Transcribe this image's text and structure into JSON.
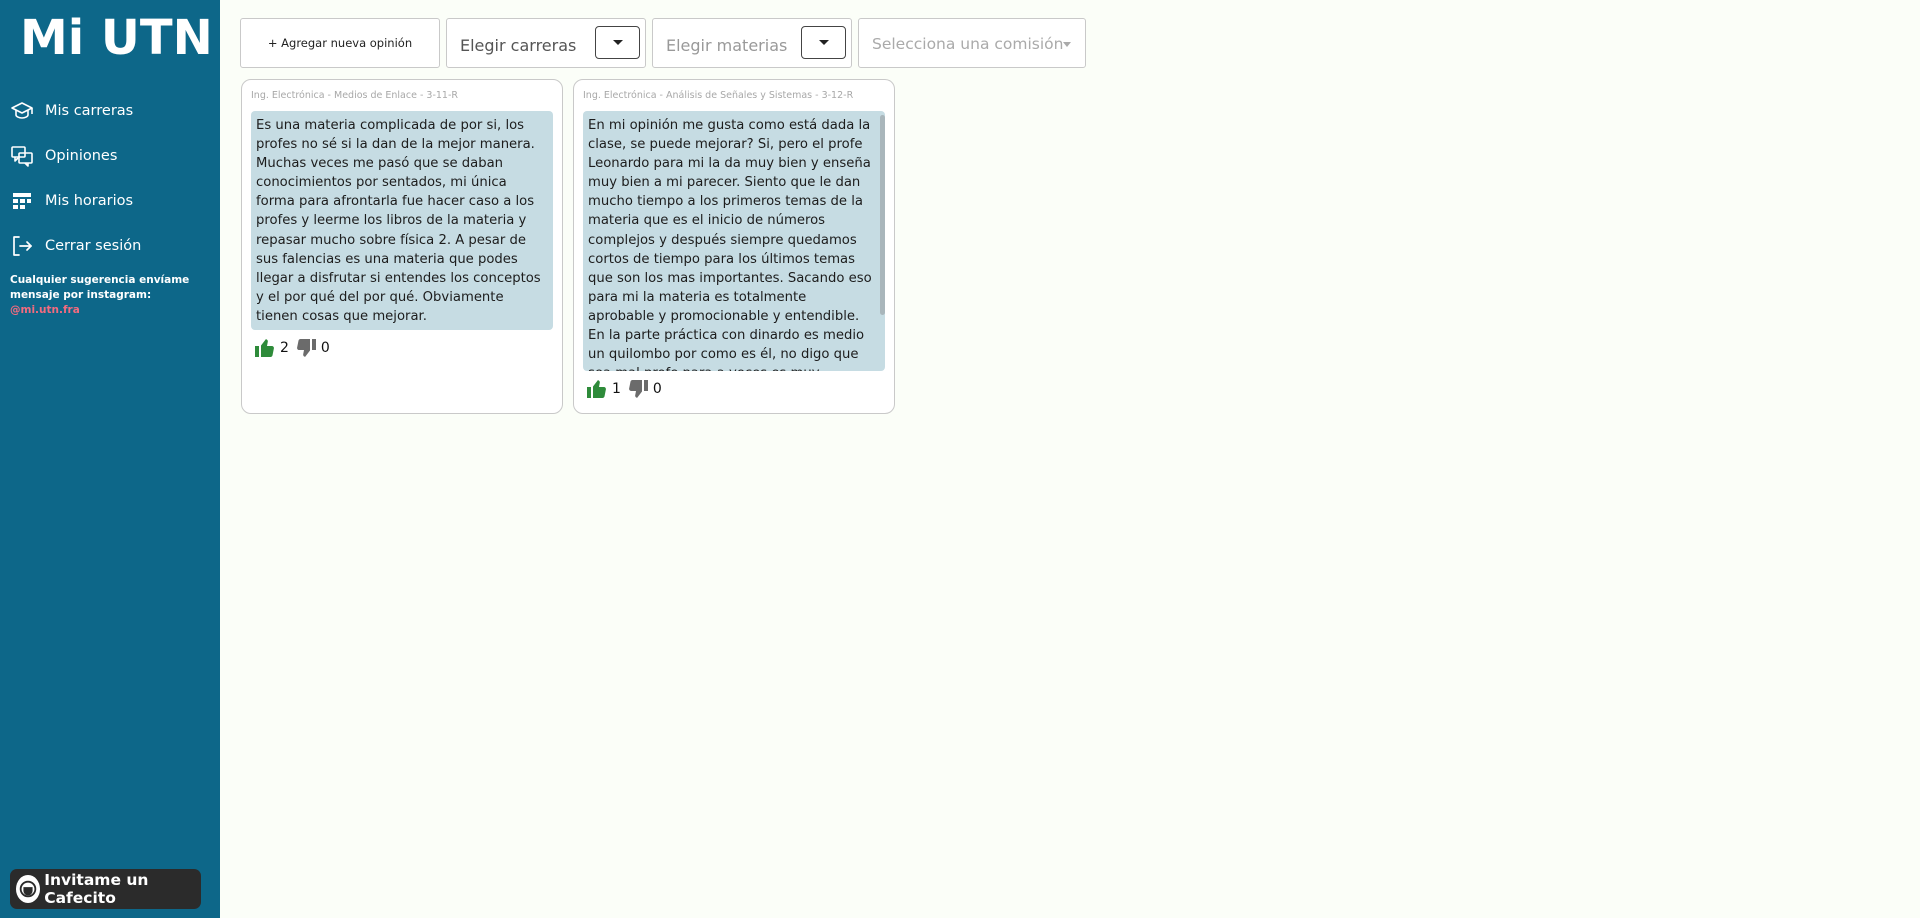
{
  "sidebar": {
    "logo": "Mi UTN",
    "items": [
      {
        "label": "Mis carreras",
        "icon": "graduation-cap-icon"
      },
      {
        "label": "Opiniones",
        "icon": "chat-icon"
      },
      {
        "label": "Mis horarios",
        "icon": "schedule-grid-icon"
      },
      {
        "label": "Cerrar sesión",
        "icon": "logout-icon"
      }
    ],
    "suggestion_text": "Cualquier sugerencia envíame mensaje por instagram: ",
    "instagram_handle": "@mi.utn.fra",
    "cafecito_label": "Invitame un Cafecito"
  },
  "toolbar": {
    "add_label": "+ Agregar nueva opinión",
    "carreras_placeholder": "Elegir carreras",
    "materias_placeholder": "Elegir materias",
    "comision_placeholder": "Selecciona una comisión"
  },
  "opinions": [
    {
      "meta": "Ing. Electrónica - Medios de Enlace - 3-11-R",
      "text": "Es una materia complicada de por si, los profes no sé si la dan de la mejor manera. Muchas veces me pasó que se daban conocimientos por sentados, mi única forma para afrontarla fue hacer caso a los profes y leerme los libros de la materia y repasar mucho sobre física 2. A pesar de sus falencias es una materia que podes llegar a disfrutar si entendes los conceptos y el por qué del por qué. Obviamente tienen cosas que mejorar.",
      "likes": "2",
      "dislikes": "0"
    },
    {
      "meta": "Ing. Electrónica - Análisis de Señales y Sistemas - 3-12-R",
      "text": "En mi opinión me gusta como está dada la clase, se puede mejorar? Si, pero el profe Leonardo para mi la da muy bien y enseña muy bien a mi parecer. Siento que le dan mucho tiempo a los primeros temas de la materia que es el inicio de números complejos y después siempre quedamos cortos de tiempo para los últimos temas que son los mas importantes. Sacando eso para mi la materia es totalmente aprobable y promocionable y entendible. En la parte práctica con dinardo es medio un quilombo por como es él, no digo que sea mal profe para a veces es muy acelerado o se marea",
      "likes": "1",
      "dislikes": "0"
    }
  ],
  "colors": {
    "sidebar": "#0d6789",
    "like": "#2e8b3a",
    "dislike": "#6b6b6b",
    "opinion_bg": "#c6dce3",
    "instagram": "#f36b7f"
  }
}
